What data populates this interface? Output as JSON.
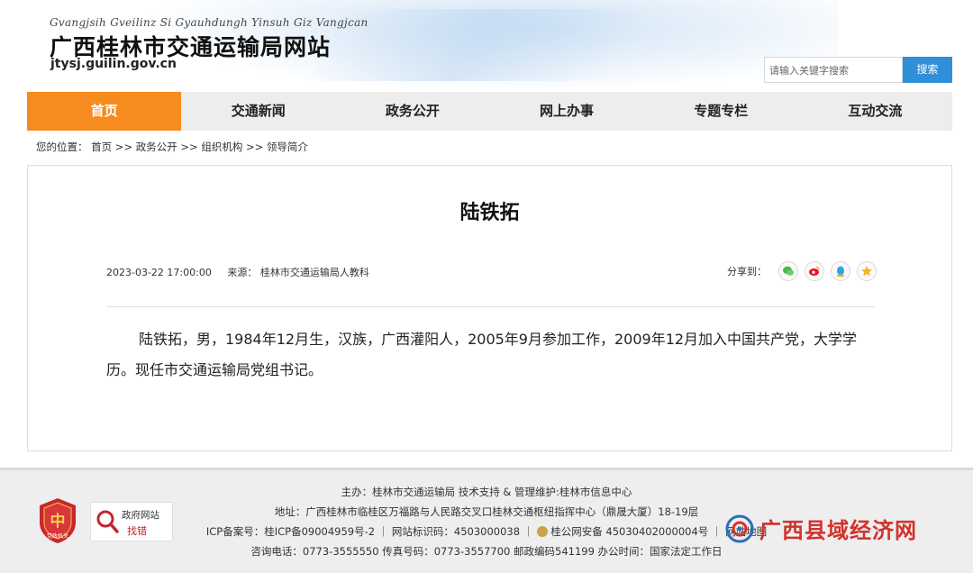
{
  "header": {
    "zhuang_title": "Gvangjsih Gveilinz Si Gyauhdungh Yinsuh Giz Vangjcan",
    "site_title": "广西桂林市交通运输局网站",
    "domain": "jtysj.guilin.gov.cn",
    "search_placeholder": "请输入关键字搜索",
    "search_button": "搜索"
  },
  "nav": {
    "active_color": "#f68b1f",
    "items": [
      {
        "label": "首页"
      },
      {
        "label": "交通新闻"
      },
      {
        "label": "政务公开"
      },
      {
        "label": "网上办事"
      },
      {
        "label": "专题专栏"
      },
      {
        "label": "互动交流"
      }
    ]
  },
  "breadcrumb": "您的位置： 首页 >> 政务公开 >> 组织机构 >> 领导简介",
  "article": {
    "title": "陆铁拓",
    "date": "2023-03-22 17:00:00",
    "source": "来源： 桂林市交通运输局人教科",
    "share_label": "分享到：",
    "share_icons": [
      "wechat-icon",
      "weibo-icon",
      "qq-icon",
      "qzone-icon"
    ],
    "body": "陆铁拓，男，1984年12月生，汉族，广西灌阳人，2005年9月参加工作，2009年12月加入中国共产党，大学学历。现任市交通运输局党组书记。"
  },
  "footer": {
    "line1": "主办：桂林市交通运输局 技术支持 & 管理维护:桂林市信息中心",
    "line2": "地址：广西桂林市临桂区万福路与人民路交叉口桂林交通枢纽指挥中心（鼎晟大厦）18-19层",
    "line3_a": "ICP备案号：桂ICP备09004959号-2 ｜ 网站标识码：4503000038 ｜",
    "line3_b": "桂公网安备 45030402000004号 ｜ 网站地图",
    "line4": "咨询电话：0773-3555550 传真号码：0773-3557700 邮政编码541199 办公时间：国家法定工作日",
    "emblem_text": "党政机关",
    "gov_error_title": "政府网站",
    "gov_error_sub": "找错"
  },
  "watermark": {
    "text": "广西县域经济网"
  }
}
